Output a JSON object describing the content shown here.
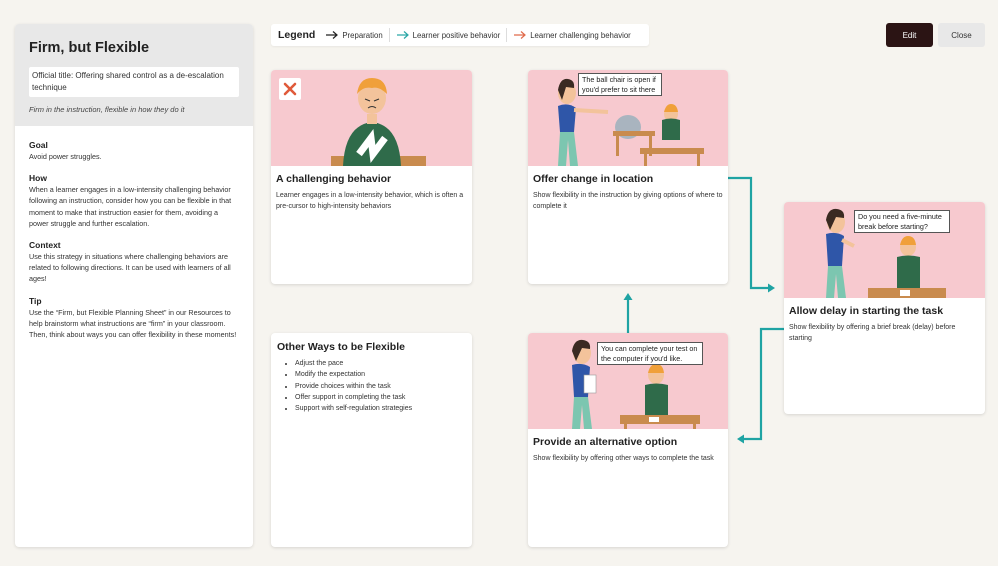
{
  "sidebar": {
    "title": "Firm, but Flexible",
    "official_title": "Official title: Offering shared control as a de-escalation technique",
    "subtitle": "Firm in the instruction, flexible in how they do it",
    "sections": [
      {
        "heading": "Goal",
        "text": "Avoid power struggles."
      },
      {
        "heading": "How",
        "text": "When a learner engages in a low-intensity challenging behavior following an instruction, consider how you can be flexible in that moment to make that instruction easier for them, avoiding a power struggle and further escalation."
      },
      {
        "heading": "Context",
        "text": "Use this strategy in situations where challenging behaviors are related to following directions. It can be used with learners of all ages!"
      },
      {
        "heading": "Tip",
        "text": "Use the “Firm, but Flexible Planning Sheet” in our Resources to help brainstorm what instructions are “firm” in your classroom. Then, think about ways you can offer flexibility in these moments!"
      }
    ]
  },
  "legend": {
    "title": "Legend",
    "items": [
      {
        "label": "Preparation",
        "color": "#222222"
      },
      {
        "label": "Learner positive behavior",
        "color": "#2aa6a6"
      },
      {
        "label": "Learner challenging behavior",
        "color": "#e06a4a"
      }
    ]
  },
  "toolbar": {
    "edit_label": "Edit",
    "close_label": "Close"
  },
  "cards": {
    "challenging": {
      "title": "A challenging behavior",
      "desc": "Learner engages in a low-intensity behavior, which is often a pre-cursor to high-intensity behaviors"
    },
    "location": {
      "title": "Offer change in location",
      "desc": "Show flexibility in the instruction by giving options of where to complete it",
      "bubble": "The ball chair is open if you'd prefer to sit there"
    },
    "delay": {
      "title": "Allow delay in starting the task",
      "desc": "Show flexibility by offering a brief break (delay) before starting",
      "bubble": "Do you need a five-minute break before starting?"
    },
    "alternative": {
      "title": "Provide an alternative option",
      "desc": "Show flexibility by offering other ways to complete the task",
      "bubble": "You can complete your test on the computer if you'd like."
    },
    "ways": {
      "title": "Other Ways to be Flexible",
      "items": [
        "Adjust the pace",
        "Modify the expectation",
        "Provide choices within the task",
        "Offer support in completing the task",
        "Support with self-regulation strategies"
      ]
    }
  },
  "colors": {
    "accent": "#2aa6a6",
    "card_image_bg": "#f7c9cf",
    "edit_bg": "#2b1414",
    "challenge_x": "#e05a3a"
  }
}
